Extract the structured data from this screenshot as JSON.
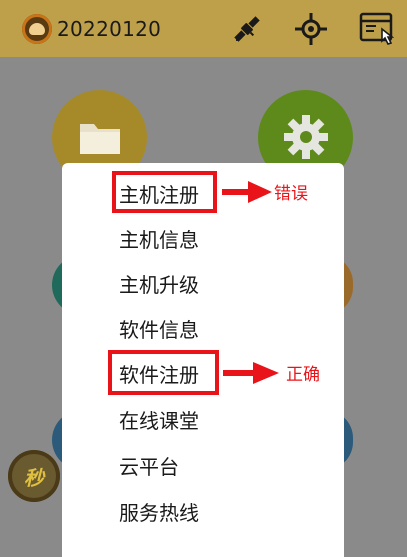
{
  "header": {
    "title": "20220120",
    "colors": {
      "bar": "#bfa04a",
      "text": "#1a1a1a"
    }
  },
  "background_icons": [
    "folder-icon",
    "gear-icon"
  ],
  "floating_button": {
    "label": "秒"
  },
  "menu": {
    "items": [
      {
        "label": "主机注册"
      },
      {
        "label": "主机信息"
      },
      {
        "label": "主机升级"
      },
      {
        "label": "软件信息"
      },
      {
        "label": "软件注册"
      },
      {
        "label": "在线课堂"
      },
      {
        "label": "云平台"
      },
      {
        "label": "服务热线"
      }
    ]
  },
  "annotations": {
    "wrong": "错误",
    "correct": "正确",
    "color": "#e8141a"
  }
}
